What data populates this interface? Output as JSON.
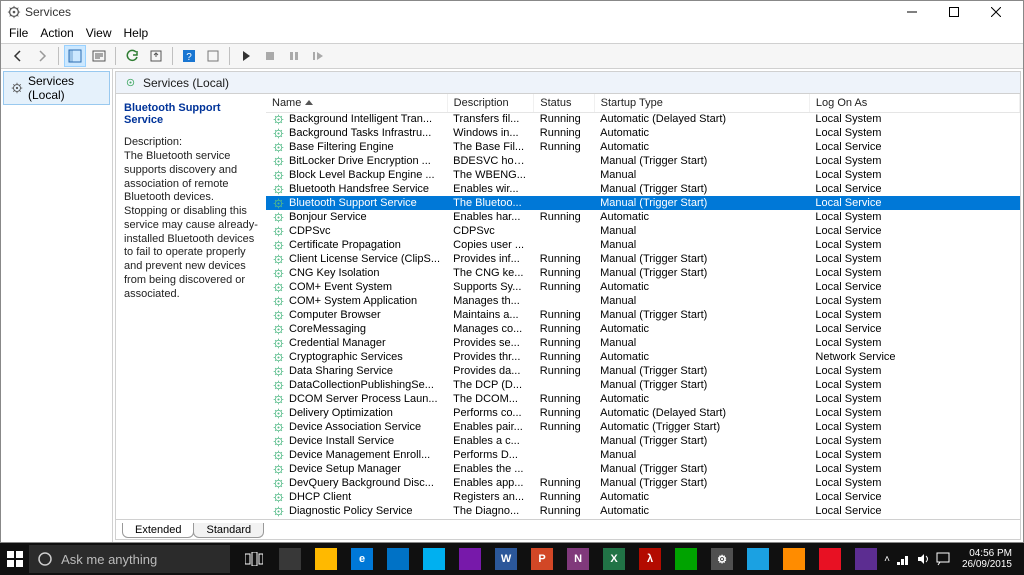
{
  "window": {
    "title": "Services",
    "menu": [
      "File",
      "Action",
      "View",
      "Help"
    ],
    "tree_node": "Services (Local)",
    "pane_header": "Services (Local)"
  },
  "detail": {
    "title": "Bluetooth Support Service",
    "desc_label": "Description:",
    "desc": "The Bluetooth service supports discovery and association of remote Bluetooth devices.  Stopping or disabling this service may cause already-installed Bluetooth devices to fail to operate properly and prevent new devices from being discovered or associated."
  },
  "columns": [
    "Name",
    "Description",
    "Status",
    "Startup Type",
    "Log On As"
  ],
  "column_widths": [
    "138px",
    "66px",
    "46px",
    "164px",
    "160px"
  ],
  "tabs": [
    "Extended",
    "Standard"
  ],
  "active_tab": 0,
  "selected_index": 6,
  "services": [
    {
      "name": "Background Intelligent Tran...",
      "desc": "Transfers fil...",
      "status": "Running",
      "startup": "Automatic (Delayed Start)",
      "logon": "Local System"
    },
    {
      "name": "Background Tasks Infrastru...",
      "desc": "Windows in...",
      "status": "Running",
      "startup": "Automatic",
      "logon": "Local System"
    },
    {
      "name": "Base Filtering Engine",
      "desc": "The Base Fil...",
      "status": "Running",
      "startup": "Automatic",
      "logon": "Local Service"
    },
    {
      "name": "BitLocker Drive Encryption ...",
      "desc": "BDESVC hos...",
      "status": "",
      "startup": "Manual (Trigger Start)",
      "logon": "Local System"
    },
    {
      "name": "Block Level Backup Engine ...",
      "desc": "The WBENG...",
      "status": "",
      "startup": "Manual",
      "logon": "Local System"
    },
    {
      "name": "Bluetooth Handsfree Service",
      "desc": "Enables wir...",
      "status": "",
      "startup": "Manual (Trigger Start)",
      "logon": "Local Service"
    },
    {
      "name": "Bluetooth Support Service",
      "desc": "The Bluetoo...",
      "status": "",
      "startup": "Manual (Trigger Start)",
      "logon": "Local Service"
    },
    {
      "name": "Bonjour Service",
      "desc": "Enables har...",
      "status": "Running",
      "startup": "Automatic",
      "logon": "Local System"
    },
    {
      "name": "CDPSvc",
      "desc": "CDPSvc",
      "status": "",
      "startup": "Manual",
      "logon": "Local Service"
    },
    {
      "name": "Certificate Propagation",
      "desc": "Copies user ...",
      "status": "",
      "startup": "Manual",
      "logon": "Local System"
    },
    {
      "name": "Client License Service (ClipS...",
      "desc": "Provides inf...",
      "status": "Running",
      "startup": "Manual (Trigger Start)",
      "logon": "Local System"
    },
    {
      "name": "CNG Key Isolation",
      "desc": "The CNG ke...",
      "status": "Running",
      "startup": "Manual (Trigger Start)",
      "logon": "Local System"
    },
    {
      "name": "COM+ Event System",
      "desc": "Supports Sy...",
      "status": "Running",
      "startup": "Automatic",
      "logon": "Local Service"
    },
    {
      "name": "COM+ System Application",
      "desc": "Manages th...",
      "status": "",
      "startup": "Manual",
      "logon": "Local System"
    },
    {
      "name": "Computer Browser",
      "desc": "Maintains a...",
      "status": "Running",
      "startup": "Manual (Trigger Start)",
      "logon": "Local System"
    },
    {
      "name": "CoreMessaging",
      "desc": "Manages co...",
      "status": "Running",
      "startup": "Automatic",
      "logon": "Local Service"
    },
    {
      "name": "Credential Manager",
      "desc": "Provides se...",
      "status": "Running",
      "startup": "Manual",
      "logon": "Local System"
    },
    {
      "name": "Cryptographic Services",
      "desc": "Provides thr...",
      "status": "Running",
      "startup": "Automatic",
      "logon": "Network Service"
    },
    {
      "name": "Data Sharing Service",
      "desc": "Provides da...",
      "status": "Running",
      "startup": "Manual (Trigger Start)",
      "logon": "Local System"
    },
    {
      "name": "DataCollectionPublishingSe...",
      "desc": "The DCP (D...",
      "status": "",
      "startup": "Manual (Trigger Start)",
      "logon": "Local System"
    },
    {
      "name": "DCOM Server Process Laun...",
      "desc": "The DCOM...",
      "status": "Running",
      "startup": "Automatic",
      "logon": "Local System"
    },
    {
      "name": "Delivery Optimization",
      "desc": "Performs co...",
      "status": "Running",
      "startup": "Automatic (Delayed Start)",
      "logon": "Local System"
    },
    {
      "name": "Device Association Service",
      "desc": "Enables pair...",
      "status": "Running",
      "startup": "Automatic (Trigger Start)",
      "logon": "Local System"
    },
    {
      "name": "Device Install Service",
      "desc": "Enables a c...",
      "status": "",
      "startup": "Manual (Trigger Start)",
      "logon": "Local System"
    },
    {
      "name": "Device Management Enroll...",
      "desc": "Performs D...",
      "status": "",
      "startup": "Manual",
      "logon": "Local System"
    },
    {
      "name": "Device Setup Manager",
      "desc": "Enables the ...",
      "status": "",
      "startup": "Manual (Trigger Start)",
      "logon": "Local System"
    },
    {
      "name": "DevQuery Background Disc...",
      "desc": "Enables app...",
      "status": "Running",
      "startup": "Manual (Trigger Start)",
      "logon": "Local System"
    },
    {
      "name": "DHCP Client",
      "desc": "Registers an...",
      "status": "Running",
      "startup": "Automatic",
      "logon": "Local Service"
    },
    {
      "name": "Diagnostic Policy Service",
      "desc": "The Diagno...",
      "status": "Running",
      "startup": "Automatic",
      "logon": "Local Service"
    }
  ],
  "taskbar": {
    "search_placeholder": "Ask me anything",
    "time": "04:56 PM",
    "date": "26/09/2015",
    "apps": [
      {
        "bg": "#383838",
        "label": ""
      },
      {
        "bg": "#ffb900",
        "label": ""
      },
      {
        "bg": "#0078d7",
        "label": "e"
      },
      {
        "bg": "#0072c6",
        "label": ""
      },
      {
        "bg": "#00b0f0",
        "label": ""
      },
      {
        "bg": "#7719aa",
        "label": ""
      },
      {
        "bg": "#2b579a",
        "label": "W"
      },
      {
        "bg": "#d24726",
        "label": "P"
      },
      {
        "bg": "#80397b",
        "label": "N"
      },
      {
        "bg": "#217346",
        "label": "X"
      },
      {
        "bg": "#b30b00",
        "label": "λ"
      },
      {
        "bg": "#00a300",
        "label": ""
      },
      {
        "bg": "#505050",
        "label": "⚙"
      },
      {
        "bg": "#1ba1e2",
        "label": ""
      },
      {
        "bg": "#ff8c00",
        "label": ""
      },
      {
        "bg": "#e81123",
        "label": ""
      },
      {
        "bg": "#5c2d91",
        "label": ""
      }
    ]
  }
}
